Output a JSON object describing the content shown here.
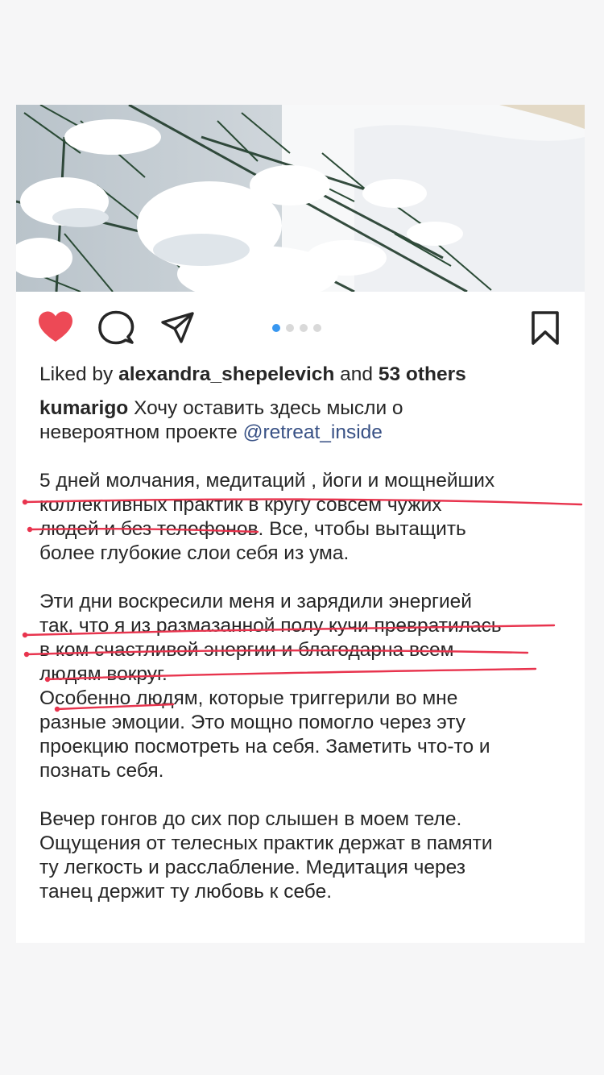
{
  "post": {
    "image_alt": "Snow-covered spruce branches",
    "carousel": {
      "total": 4,
      "active": 1
    },
    "actions": {
      "like_icon": "heart-icon",
      "comment_icon": "comment-icon",
      "share_icon": "send-icon",
      "save_icon": "bookmark-icon",
      "liked_color": "#ed4956"
    },
    "likes": {
      "prefix": "Liked by ",
      "user": "alexandra_shepelevich",
      "middle": " and ",
      "others": "53 others"
    },
    "caption": {
      "username": "kumarigo",
      "intro_1": " Хочу оставить здесь мысли о",
      "intro_2": "невероятном проекте ",
      "mention": "@retreat_inside",
      "p1": [
        "5 дней молчания, медитаций , йоги и мощнейших",
        "коллективных практик в кругу  совсем чужих",
        "людей и без телефонов. Все, чтобы вытащить",
        "более глубокие слои себя из ума."
      ],
      "p2": [
        "Эти дни воскресили меня и зарядили энергией",
        "так, что я из размазанной полу кучи превратилась",
        "в ком счастливой энергии и благодарна всем",
        "людям вокруг.",
        "Особенно людям, которые триггерили во мне",
        "разные эмоции. Это мощно помогло через эту",
        "проекцию посмотреть на себя. Заметить что-то и",
        "познать себя."
      ],
      "p3": [
        "Вечер гонгов до сих пор слышен в моем теле.",
        "Ощущения от телесных практик держат в памяти",
        "ту легкость и расслабление. Медитация через",
        "танец держит ту любовь к себе."
      ]
    },
    "annotation_color": "#e8344e"
  }
}
